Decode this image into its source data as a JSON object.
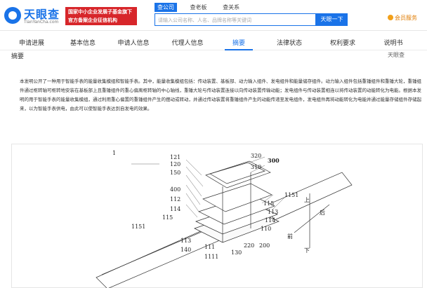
{
  "header": {
    "logo_text": "天眼查",
    "logo_sub": "TianYanCha.com",
    "gov_badge": "国家中小企业发展子基金旗下\n官方备案企业征信机构",
    "search_tabs": [
      "查公司",
      "查老板",
      "查关系"
    ],
    "search_placeholder": "请输入公司名称、人名、品牌名称等关键词",
    "search_button": "天眼一下",
    "member": "会员服务"
  },
  "tabs": [
    "申请进展",
    "基本信息",
    "申请人信息",
    "代理人信息",
    "摘要",
    "法律状态",
    "权利要求",
    "说明书"
  ],
  "active_tab": "摘要",
  "abstract": {
    "heading": "摘要",
    "watermark": "天眼查",
    "text": "本发明公开了一种用于智能手表的能量收集模组和智能手表。其中，能量收集模组包括：传动装置、基板部、动力输入组件、发电组件和能量储存组件。动力输入组件包括重锤组件和重锤大轮，重锤组件通过枢转轴可枢转地安装在基板部上且重锤组件的重心偏离枢转轴的中心轴线，重锤大轮与传动装置连接以向传动装置传输动能；发电组件与传动装置相连以将传动装置的动能转化为电能。根据本发明的用于智能手表的能量收集模组，通过利用重心偏置的重锤组件产生的摆动或转动，并通过传动装置将重锤组件产生的动能传递至发电组件，发电组件再将动能转化为电能并通过能量存储组件存储起来，以为智能手表供电，由此可以使智能手表达到自发电的效果。"
  },
  "figure": {
    "labels": [
      "1",
      "121",
      "120",
      "150",
      "400",
      "112",
      "114",
      "115",
      "1151",
      "113",
      "140",
      "111",
      "1111",
      "130",
      "220",
      "200",
      "110",
      "114",
      "113",
      "115",
      "1151",
      "320",
      "300",
      "310",
      "上",
      "下",
      "后",
      "前"
    ]
  }
}
